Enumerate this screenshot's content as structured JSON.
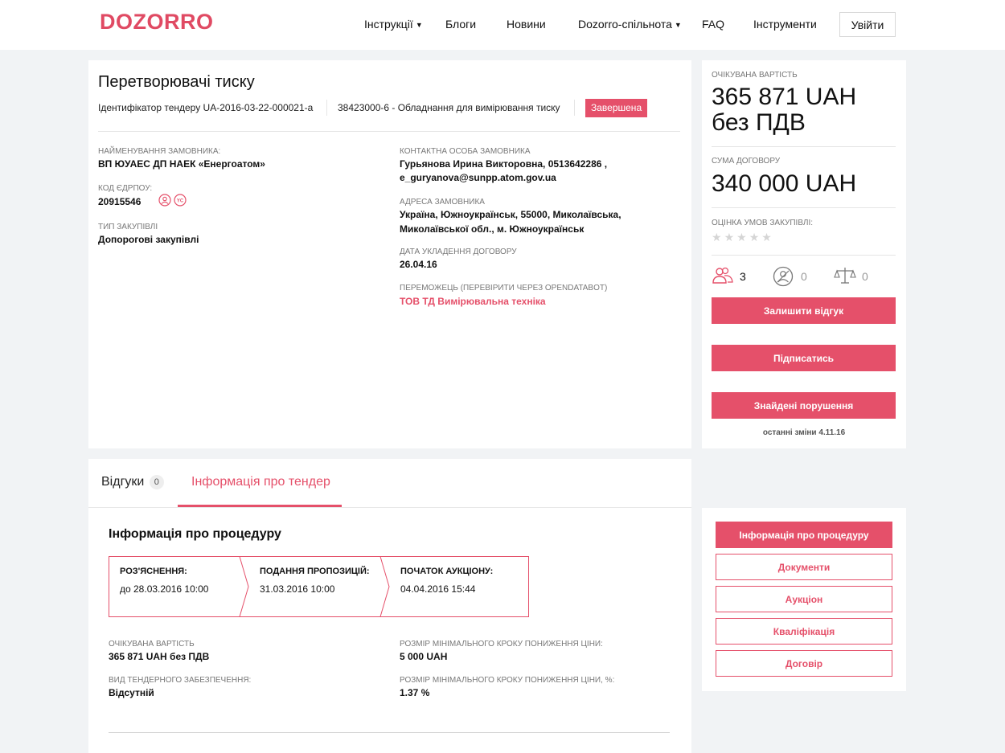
{
  "header": {
    "logo": "DOZORRO",
    "nav": [
      {
        "label": "Інструкції",
        "dropdown": true
      },
      {
        "label": "Блоги",
        "dropdown": false
      },
      {
        "label": "Новини",
        "dropdown": false
      },
      {
        "label": "Dozorro-спільнота",
        "dropdown": true
      },
      {
        "label": "FAQ",
        "dropdown": false
      },
      {
        "label": "Інструменти",
        "dropdown": false
      }
    ],
    "login_label": "Увійти"
  },
  "tender": {
    "title": "Перетворювачі тиску",
    "id_text": "Ідентифікатор тендеру UA-2016-03-22-000021-a",
    "cpv": "38423000-6 - Обладнання для вимірювання тиску",
    "status": "Завершена",
    "customer_label": "Найменування замовника:",
    "customer_value": "ВП ЮУАЕС ДП НАЕК «Енергоатом»",
    "edrpou_label": "Код ЄДРПОУ:",
    "edrpou_value": "20915546",
    "procurement_type_label": "Тип закупівлі",
    "procurement_type_value": "Допорогові закупівлі",
    "contact_label": "Контактна особа замовника",
    "contact_line1": "Гурьянова Ирина Викторовна, 0513642286 ,",
    "contact_line2": "e_guryanova@sunpp.atom.gov.ua",
    "address_label": "Адреса замовника",
    "address_line1": "Україна, Южноукраїнськ, 55000, Миколаївська,",
    "address_line2": "Миколаївської обл., м. Южноукраїнськ",
    "contract_date_label": "Дата укладення договору",
    "contract_date_value": "26.04.16",
    "winner_label": "Переможець (перевірити через OPENDATABOT)",
    "winner_value": "ТОВ ТД Вимірювальна техніка"
  },
  "sidebar": {
    "expected_label": "Очікувана вартість",
    "expected_value_line1": "365 871 UAH",
    "expected_value_line2": "без ПДВ",
    "contract_sum_label": "Сума договору",
    "contract_sum_value": "340 000 UAH",
    "rating_label": "Оцінка умов закупівлі:",
    "rating_stars": 0,
    "rating_max": 5,
    "stats": [
      {
        "icon": "participants-icon",
        "value": "3"
      },
      {
        "icon": "complaints-icon",
        "value": "0"
      },
      {
        "icon": "scales-icon",
        "value": "0"
      }
    ],
    "buttons": [
      "Залишити відгук",
      "Підписатись",
      "Знайдені порушення"
    ],
    "last_changes": "останні зміни 4.11.16"
  },
  "tabs": {
    "reviews_label": "Відгуки",
    "reviews_count": "0",
    "info_label": "Інформація про тендер"
  },
  "procedure": {
    "title": "Інформація про процедуру",
    "stages": [
      {
        "title": "РОЗ'ЯСНЕННЯ:",
        "date": "до 28.03.2016 10:00"
      },
      {
        "title": "ПОДАННЯ ПРОПОЗИЦІЙ:",
        "date": "31.03.2016 10:00"
      },
      {
        "title": "ПОЧАТОК АУКЦІОНУ:",
        "date": "04.04.2016 15:44"
      }
    ],
    "expected_label": "Очікувана вартість",
    "expected_value": "365 871 UAH без ПДВ",
    "min_step_label": "Розмір мінімального кроку пониження ціни:",
    "min_step_value": "5 000 UAH",
    "security_label": "Вид тендерного забезпечення:",
    "security_value": "Відсутній",
    "min_step_pct_label": "Розмір мінімального кроку пониження ціни, %:",
    "min_step_pct_value": "1.37 %"
  },
  "section_nav": [
    "Інформація про процедуру",
    "Документи",
    "Аукціон",
    "Кваліфікація",
    "Договір"
  ],
  "colors": {
    "accent": "#e5506a",
    "background": "#f1f3f5"
  }
}
